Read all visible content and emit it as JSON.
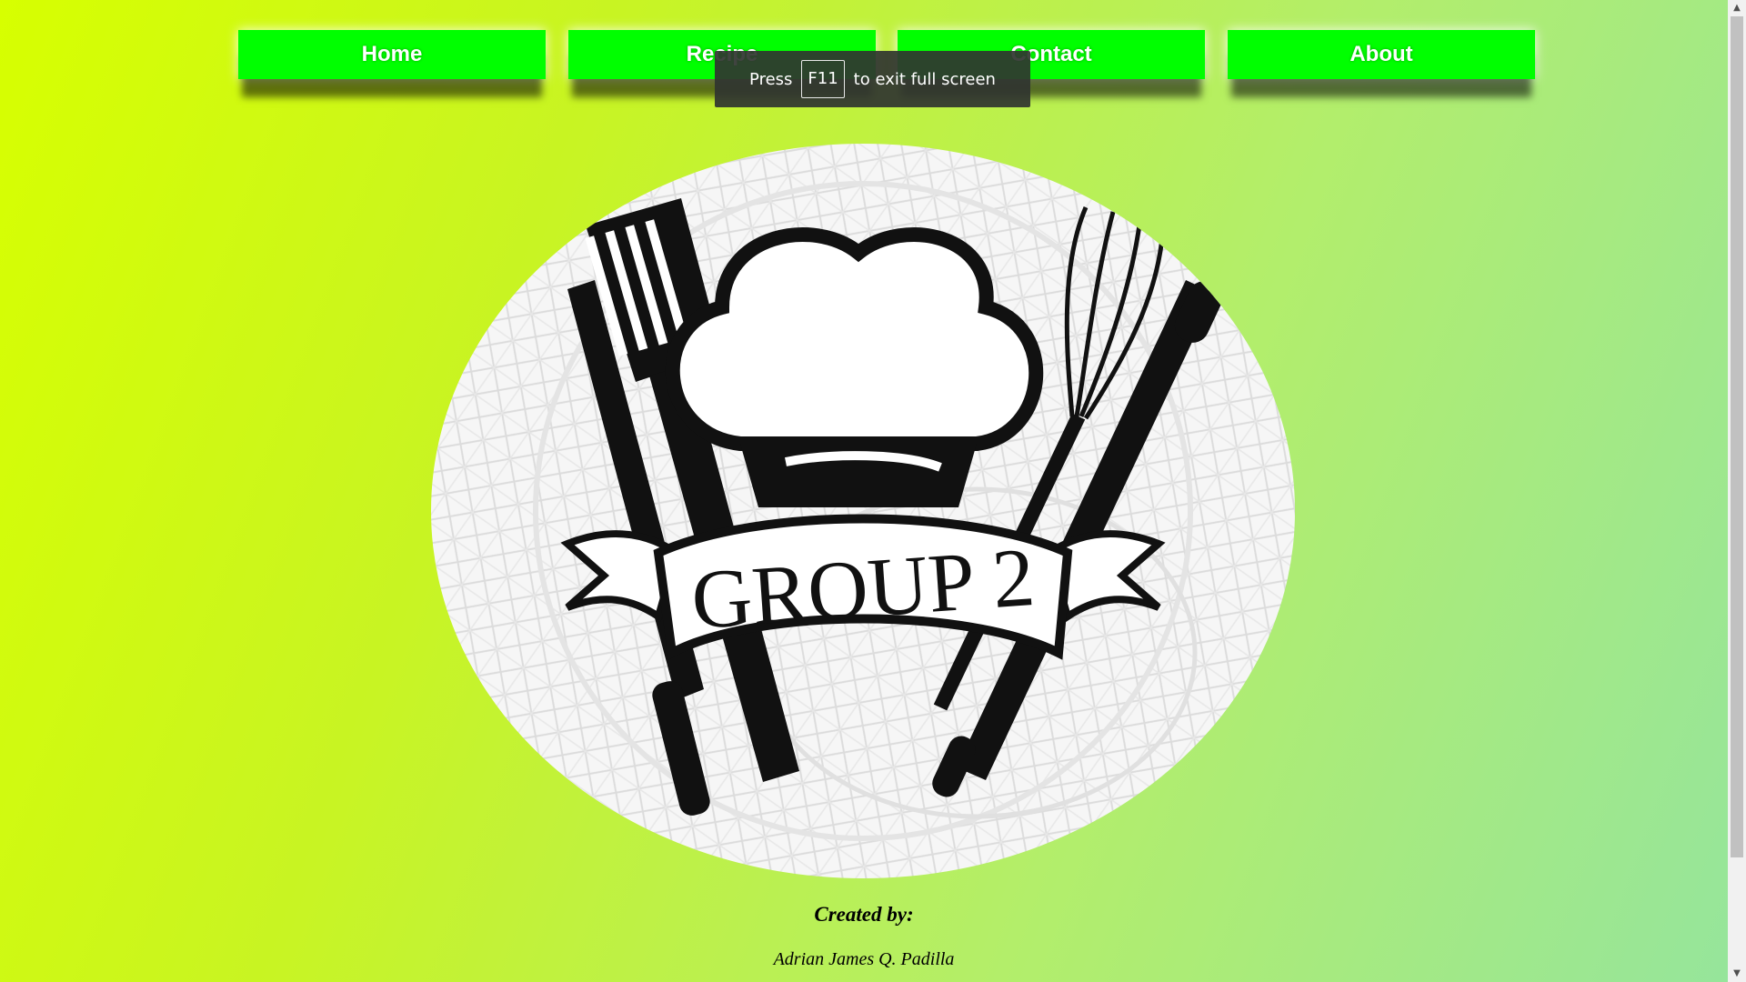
{
  "nav": {
    "items": [
      {
        "label": "Home"
      },
      {
        "label": "Recipe"
      },
      {
        "label": "Contact"
      },
      {
        "label": "About"
      }
    ],
    "button_color": "#00ff00"
  },
  "fullscreen_toast": {
    "prefix": "Press",
    "key": "F11",
    "suffix": "to exit full screen"
  },
  "logo": {
    "text": "GROUP 2"
  },
  "credits": {
    "heading": "Created by:",
    "name": "Adrian James Q. Padilla"
  },
  "colors": {
    "bg_start": "#d7ff00",
    "bg_end": "#96e59b"
  }
}
